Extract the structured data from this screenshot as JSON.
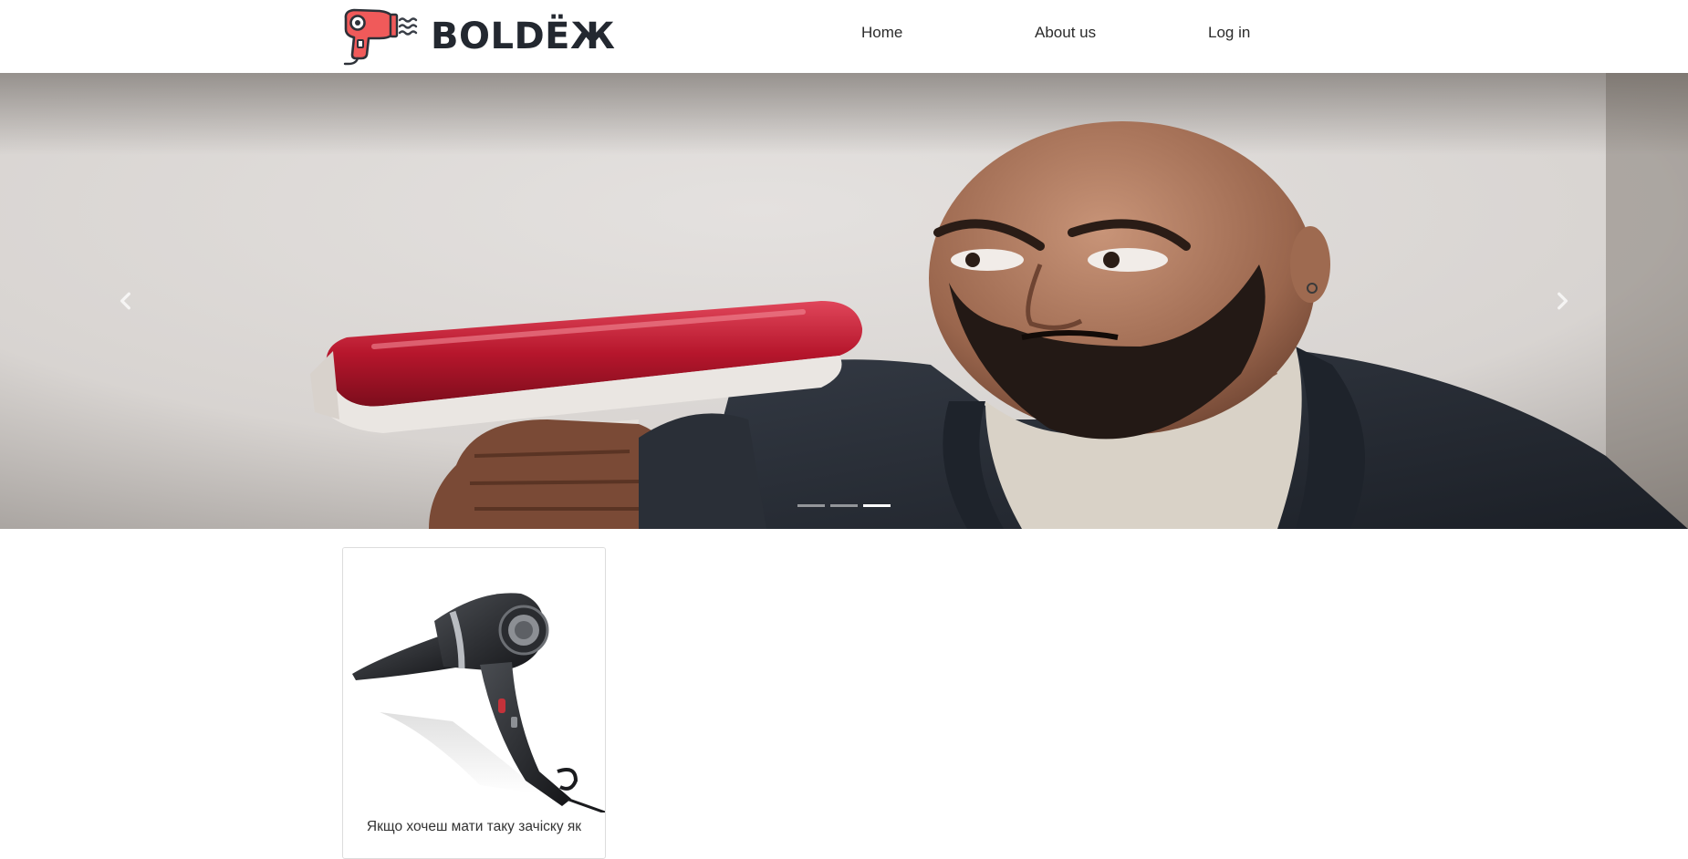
{
  "brand": {
    "name": "BOLDЁЖ",
    "logo_icon": "hair-dryer-icon",
    "logo_color": "#f05a5a"
  },
  "nav": {
    "items": [
      {
        "label": "Home"
      },
      {
        "label": "About us"
      },
      {
        "label": "Log in"
      }
    ]
  },
  "carousel": {
    "slide_count": 3,
    "active_index": 2,
    "slide_image": "photo of a bald bearded man in a dark suit frowning at a red and white hair dryer",
    "prev_icon": "chevron-left-icon",
    "next_icon": "chevron-right-icon"
  },
  "products": [
    {
      "image": "photo of a black professional hair dryer",
      "text": "Якщо хочеш мати таку зачіску як"
    }
  ]
}
